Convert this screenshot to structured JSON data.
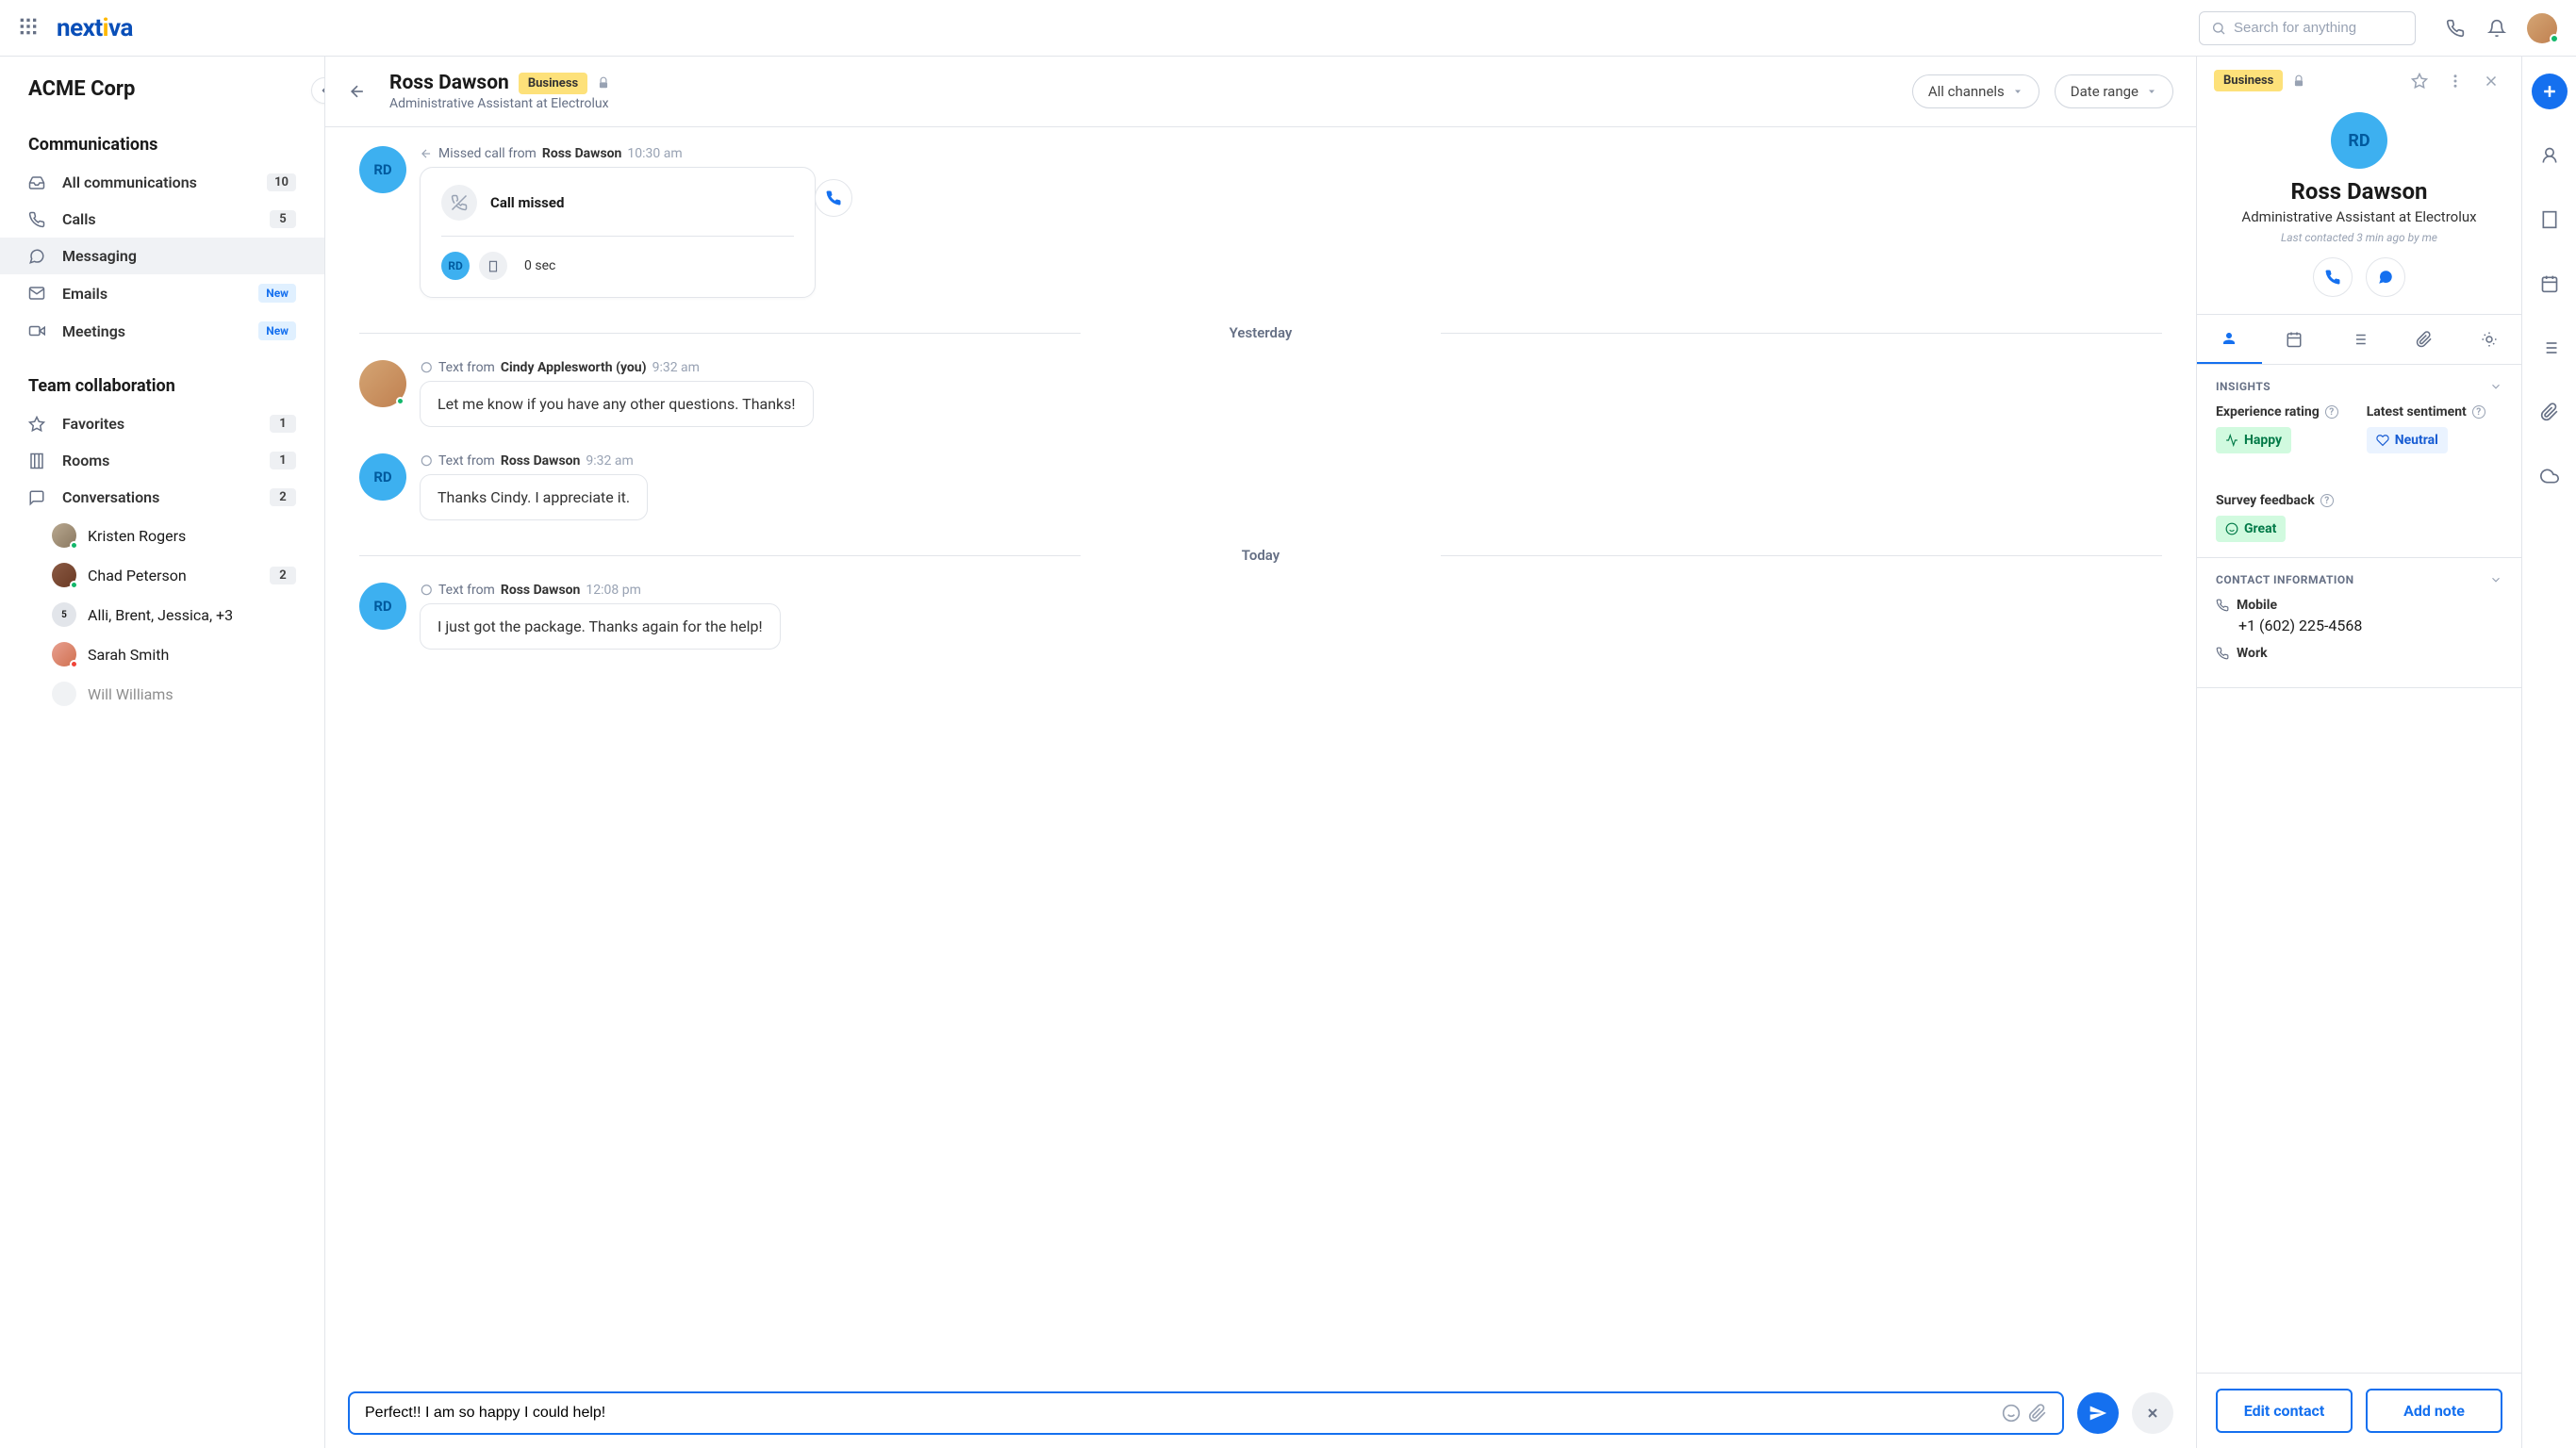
{
  "search_placeholder": "Search for anything",
  "org_name": "ACME Corp",
  "sections": {
    "comms_title": "Communications",
    "collab_title": "Team collaboration"
  },
  "nav": {
    "all": {
      "label": "All communications",
      "count": "10"
    },
    "calls": {
      "label": "Calls",
      "count": "5"
    },
    "messaging": {
      "label": "Messaging"
    },
    "emails": {
      "label": "Emails",
      "pill": "New"
    },
    "meetings": {
      "label": "Meetings",
      "pill": "New"
    },
    "favorites": {
      "label": "Favorites",
      "count": "1"
    },
    "rooms": {
      "label": "Rooms",
      "count": "1"
    },
    "conversations": {
      "label": "Conversations",
      "count": "2"
    }
  },
  "convos": [
    {
      "name": "Kristen Rogers"
    },
    {
      "name": "Chad Peterson",
      "count": "2"
    },
    {
      "name": "Alli, Brent, Jessica, +3"
    },
    {
      "name": "Sarah Smith"
    },
    {
      "name": "Will Williams"
    }
  ],
  "centerHeader": {
    "name": "Ross Dawson",
    "badge": "Business",
    "subtitle": "Administrative Assistant at Electrolux",
    "filter1": "All channels",
    "filter2": "Date range"
  },
  "thread": {
    "call": {
      "meta_prefix": "Missed call from",
      "meta_name": "Ross Dawson",
      "meta_time": "10:30 am",
      "card_title": "Call missed",
      "duration": "0 sec",
      "initials": "RD"
    },
    "divider1": "Yesterday",
    "divider2": "Today",
    "msg1": {
      "prefix": "Text from",
      "name": "Cindy Applesworth (you)",
      "time": "9:32 am",
      "body": "Let me know if you have any other questions. Thanks!"
    },
    "msg2": {
      "prefix": "Text from",
      "name": "Ross Dawson",
      "time": "9:32 am",
      "body": "Thanks Cindy. I appreciate it.",
      "initials": "RD"
    },
    "msg3": {
      "prefix": "Text from",
      "name": "Ross Dawson",
      "time": "12:08 pm",
      "body": "I just got the package. Thanks again for the help!",
      "initials": "RD"
    }
  },
  "composer_value": "Perfect!! I am so happy I could help!",
  "detail": {
    "badge": "Business",
    "initials": "RD",
    "name": "Ross Dawson",
    "subtitle": "Administrative Assistant at Electrolux",
    "last_contact": "Last contacted 3 min ago by me",
    "insights_title": "INSIGHTS",
    "exp_label": "Experience rating",
    "exp_value": "Happy",
    "sent_label": "Latest sentiment",
    "sent_value": "Neutral",
    "survey_label": "Survey feedback",
    "survey_value": "Great",
    "contact_title": "CONTACT INFORMATION",
    "mobile_label": "Mobile",
    "mobile_value": "+1 (602) 225-4568",
    "work_label": "Work",
    "edit_btn": "Edit contact",
    "note_btn": "Add note"
  }
}
